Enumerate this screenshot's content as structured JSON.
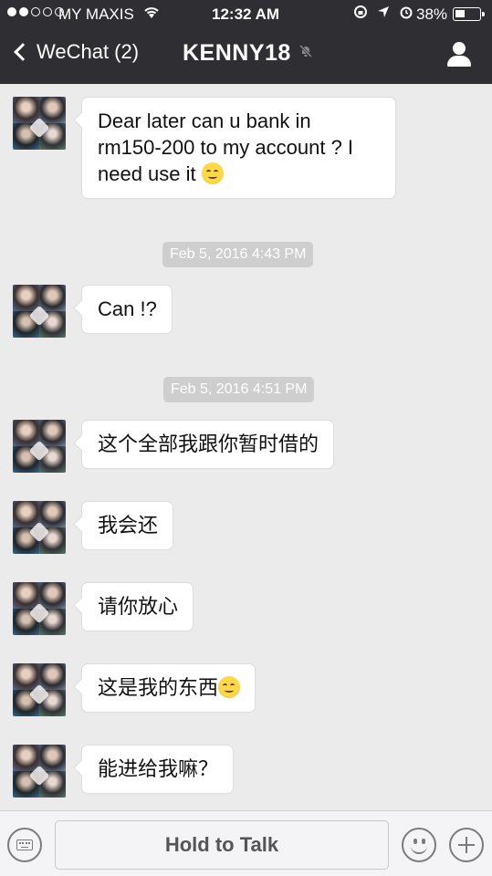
{
  "status_bar": {
    "carrier": "MY MAXIS",
    "time": "12:32 AM",
    "battery_percent": "38%",
    "signal_bars_filled": 2,
    "signal_bars_total": 5
  },
  "nav": {
    "back_label": "WeChat (2)",
    "title": "KENNY18",
    "mute_icon": "bell-slash-icon",
    "profile_icon": "person-icon"
  },
  "messages": [
    {
      "type": "message",
      "lines": [
        "Dear later can u bank in",
        "rm150-200 to my account ? I",
        "need use it"
      ],
      "emoji_after": true
    },
    {
      "type": "timestamp",
      "text": "Feb 5, 2016 4:43 PM"
    },
    {
      "type": "message",
      "lines": [
        "Can !?"
      ]
    },
    {
      "type": "timestamp",
      "text": "Feb 5, 2016 4:51 PM"
    },
    {
      "type": "message",
      "lines": [
        "这个全部我跟你暂时借的"
      ]
    },
    {
      "type": "message",
      "lines": [
        "我会还"
      ]
    },
    {
      "type": "message",
      "lines": [
        "请你放心"
      ]
    },
    {
      "type": "message",
      "lines": [
        "这是我的东西"
      ],
      "emoji_after": true
    },
    {
      "type": "message",
      "lines": [
        "能进给我嘛？"
      ]
    }
  ],
  "input_bar": {
    "talk_label": "Hold to Talk",
    "keyboard_icon": "keyboard-icon",
    "emoji_icon": "smiley-icon",
    "plus_icon": "plus-icon"
  },
  "colors": {
    "nav_background": "#2e2e33",
    "chat_background": "#ebebeb",
    "bubble_background": "#ffffff",
    "timestamp_background": "#cecece"
  }
}
